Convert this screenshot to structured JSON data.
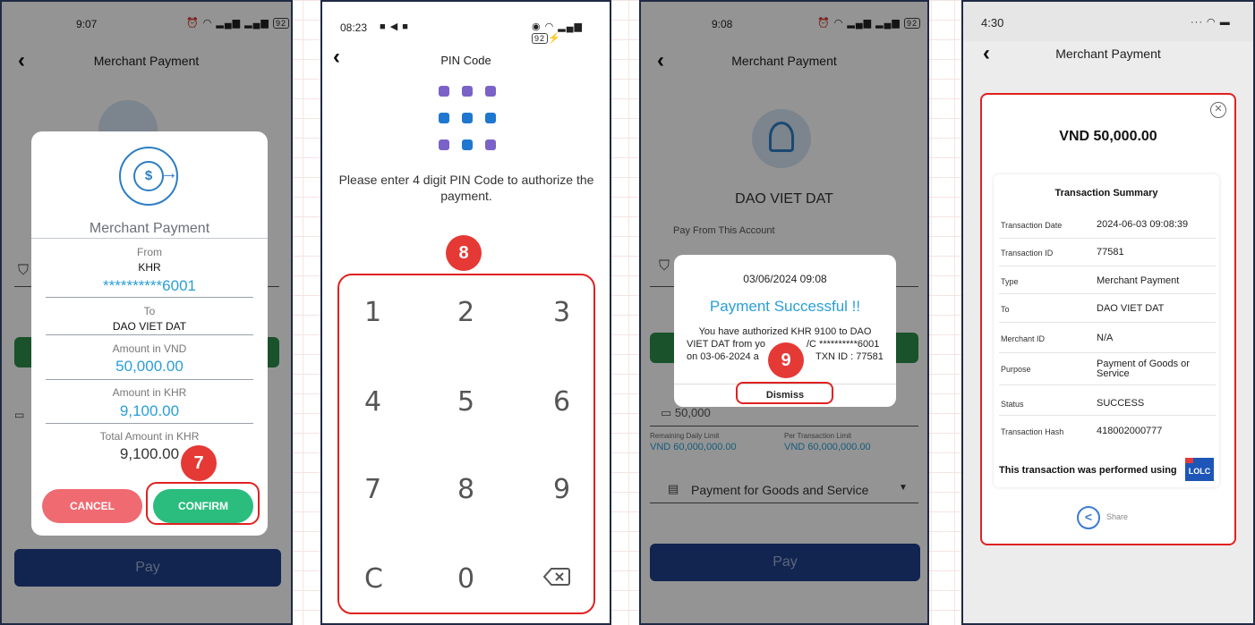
{
  "screen1": {
    "status_time": "9:07",
    "status_battery": "92",
    "header_title": "Merchant Payment",
    "dialog": {
      "title": "Merchant Payment",
      "from_label": "From",
      "from_currency": "KHR",
      "from_account": "**********6001",
      "to_label": "To",
      "to_value": "DAO VIET DAT",
      "amount_vnd_label": "Amount in VND",
      "amount_vnd_value": "50,000.00",
      "amount_khr_label": "Amount in KHR",
      "amount_khr_value": "9,100.00",
      "total_khr_label": "Total Amount in KHR",
      "total_khr_value": "9,100.00",
      "cancel_label": "CANCEL",
      "confirm_label": "CONFIRM"
    },
    "pay_label": "Pay",
    "step_number": "7"
  },
  "screen2": {
    "status_time": "08:23",
    "status_battery": "92",
    "header_title": "PIN Code",
    "instruction": "Please enter 4 digit PIN Code to authorize the payment.",
    "step_number": "8",
    "keys": [
      "1",
      "2",
      "3",
      "4",
      "5",
      "6",
      "7",
      "8",
      "9",
      "C",
      "0"
    ],
    "dot_colors": [
      "#7b62c6",
      "#7b62c6",
      "#7b62c6",
      "#1f77d0",
      "#1f77d0",
      "#1f77d0",
      "#7b62c6",
      "#1f77d0",
      "#7b62c6"
    ]
  },
  "screen3": {
    "status_time": "9:08",
    "status_battery": "92",
    "header_title": "Merchant Payment",
    "merchant_name": "DAO VIET DAT",
    "pay_from_label": "Pay From This Account",
    "amount_placeholder": "50,000",
    "remaining_label": "Remaining Daily Limit",
    "remaining_value": "VND 60,000,000.00",
    "per_txn_label": "Per Transaction Limit",
    "per_txn_value": "VND 60,000,000.00",
    "purpose_value": "Payment for Goods and Service",
    "pay_label": "Pay",
    "dialog": {
      "datetime": "03/06/2024 09:08",
      "title": "Payment Successful !!",
      "message_line1": "You have authorized KHR 9100 to DAO",
      "message_line2": "VIET DAT from yo",
      "message_line2b": "/C **********6001",
      "message_line3": "on 03-06-2024 a",
      "message_line3b": "TXN ID : 77581",
      "dismiss_label": "Dismiss"
    },
    "step_number": "9"
  },
  "screen4": {
    "status_time": "4:30",
    "header_title": "Merchant Payment",
    "amount": "VND 50,000.00",
    "summary_title": "Transaction Summary",
    "rows": [
      {
        "label": "Transaction Date",
        "value": "2024-06-03 09:08:39"
      },
      {
        "label": "Transaction ID",
        "value": "77581"
      },
      {
        "label": "Type",
        "value": "Merchant Payment"
      },
      {
        "label": "To",
        "value": "DAO VIET DAT"
      },
      {
        "label": "Merchant ID",
        "value": "N/A"
      },
      {
        "label": "Purpose",
        "value": "Payment of Goods or Service"
      },
      {
        "label": "Status",
        "value": "SUCCESS"
      },
      {
        "label": "Transaction Hash",
        "value": "418002000777"
      }
    ],
    "performed_using": "This transaction was performed using",
    "logo_text": "LOLC",
    "share_label": "Share"
  }
}
